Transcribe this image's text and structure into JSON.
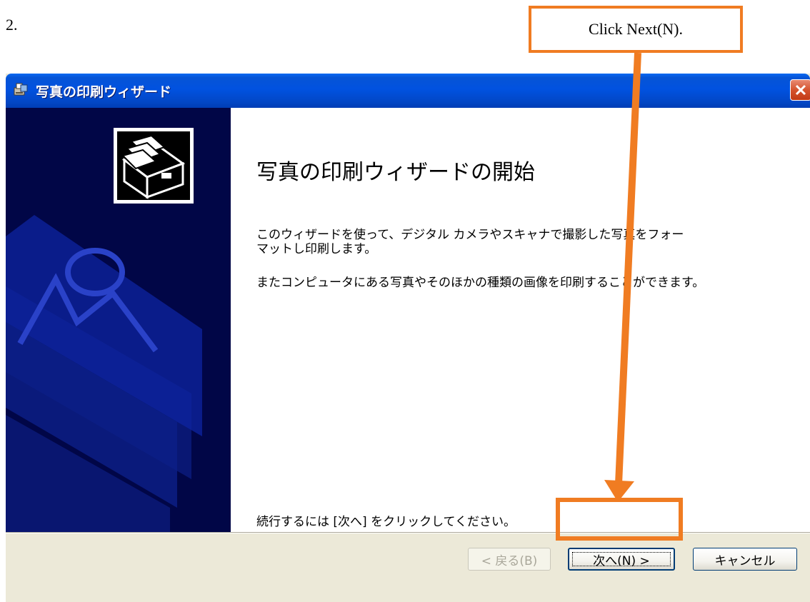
{
  "step": {
    "number": "2."
  },
  "callout": {
    "text": "Click Next(N)."
  },
  "window": {
    "title": "写真の印刷ウィザード",
    "icon": "printer-photo-icon",
    "close_icon": "close-icon"
  },
  "content": {
    "heading": "写真の印刷ウィザードの開始",
    "paragraph1": "このウィザードを使って、デジタル カメラやスキャナで撮影した写真をフォーマットし印刷します。",
    "paragraph2": "またコンピュータにある写真やそのほかの種類の画像を印刷することができます。",
    "continue_hint": "続行するには [次へ] をクリックしてください。"
  },
  "buttons": {
    "back": "< 戻る(B)",
    "next": "次へ(N) >",
    "cancel": "キャンセル"
  },
  "colors": {
    "callout_border": "#f07c22",
    "titlebar": "#0152e0",
    "side_panel": "#010647"
  }
}
